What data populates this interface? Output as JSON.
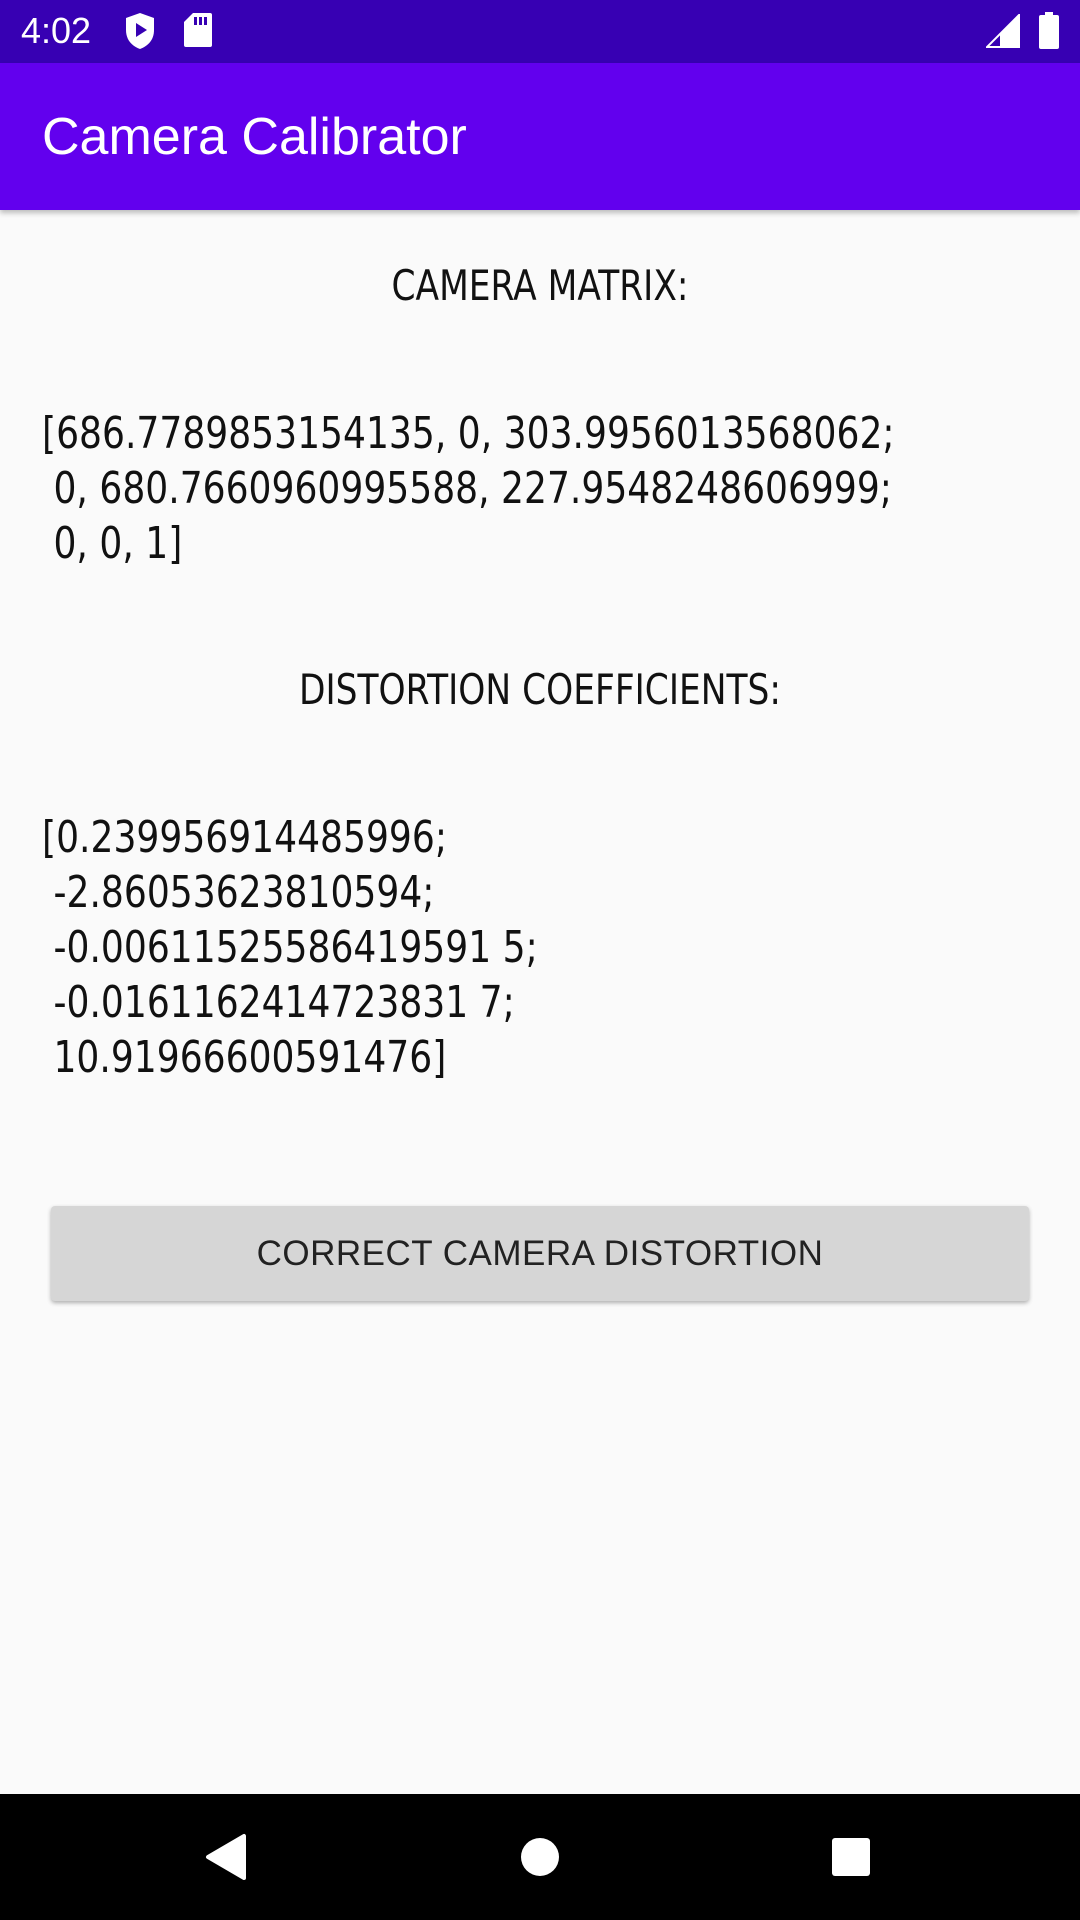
{
  "status_bar": {
    "time": "4:02",
    "icons": [
      "shield-icon",
      "sd-card-icon",
      "cell-signal-icon",
      "battery-icon"
    ]
  },
  "app_bar": {
    "title": "Camera Calibrator"
  },
  "camera_matrix": {
    "heading": "CAMERA MATRIX:",
    "value": "[686.7789853154135, 0, 303.9956013568062;\n 0, 680.7660960995588, 227.9548248606999;\n 0, 0, 1]"
  },
  "distortion": {
    "heading": "DISTORTION COEFFICIENTS:",
    "value": "[0.239956914485996;\n -2.86053623810594;\n -0.00611525586419591 5;\n -0.0161162414723831 7;\n 10.91966600591476]"
  },
  "actions": {
    "correct_label": "CORRECT CAMERA DISTORTION"
  },
  "nav_bar": {
    "icons": [
      "back-icon",
      "home-icon",
      "recents-icon"
    ]
  },
  "colors": {
    "status_bar": "#3700b3",
    "app_bar": "#6200ee",
    "background": "#fafafa",
    "button": "#d6d6d6"
  }
}
